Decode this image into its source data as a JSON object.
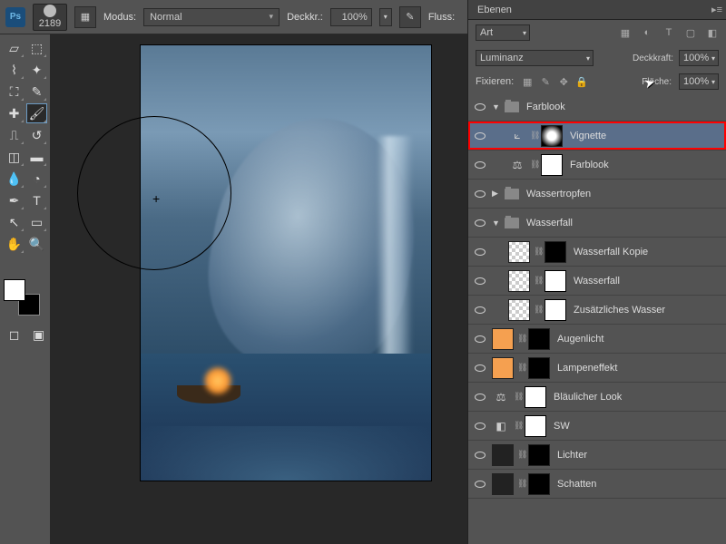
{
  "topbar": {
    "brush_size": "2189",
    "mode_label": "Modus:",
    "mode_value": "Normal",
    "opacity_label": "Deckkr.:",
    "opacity_value": "100%",
    "flow_label": "Fluss:"
  },
  "panel": {
    "title": "Ebenen",
    "filter": "Art",
    "blend_mode": "Luminanz",
    "opacity_label": "Deckkraft:",
    "opacity_value": "100%",
    "lock_label": "Fixieren:",
    "fill_label": "Fläche:",
    "fill_value": "100%"
  },
  "layers": [
    {
      "type": "group",
      "name": "Farblook",
      "expanded": true,
      "level": 0
    },
    {
      "type": "adj",
      "name": "Vignette",
      "icon": "curves",
      "level": 1,
      "selected": true,
      "highlight": true,
      "mask": "vignette"
    },
    {
      "type": "adj",
      "name": "Farblook",
      "icon": "balance",
      "level": 1,
      "mask": "white"
    },
    {
      "type": "group",
      "name": "Wassertropfen",
      "expanded": false,
      "level": 0
    },
    {
      "type": "group",
      "name": "Wasserfall",
      "expanded": true,
      "level": 0
    },
    {
      "type": "img",
      "name": "Wasserfall Kopie",
      "thumb": "checker",
      "level": 1,
      "mask": "dark"
    },
    {
      "type": "img",
      "name": "Wasserfall",
      "thumb": "checker",
      "level": 1,
      "mask": "white"
    },
    {
      "type": "img",
      "name": "Zusätzliches Wasser",
      "thumb": "checker",
      "level": 1,
      "mask": "white"
    },
    {
      "type": "fill",
      "name": "Augenlicht",
      "thumb": "orange",
      "level": 0,
      "mask": "dark"
    },
    {
      "type": "fill",
      "name": "Lampeneffekt",
      "thumb": "orange",
      "level": 0,
      "mask": "dark"
    },
    {
      "type": "adj",
      "name": "Bläulicher Look",
      "icon": "balance",
      "level": 0,
      "mask": "white"
    },
    {
      "type": "adj",
      "name": "SW",
      "icon": "gray",
      "level": 0,
      "mask": "white"
    },
    {
      "type": "fill",
      "name": "Lichter",
      "thumb": "dark",
      "level": 0,
      "mask": "dark"
    },
    {
      "type": "fill",
      "name": "Schatten",
      "thumb": "dark",
      "level": 0,
      "mask": "dark"
    }
  ]
}
